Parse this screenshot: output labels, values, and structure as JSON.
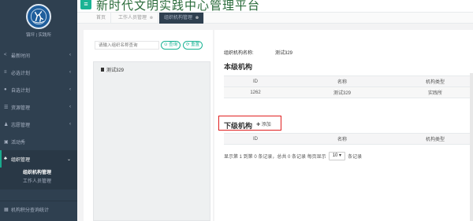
{
  "app": {
    "title": "新时代文明实践中心管理平台",
    "menu_icon": "hamburger-icon"
  },
  "profile": {
    "name": "镇坪 | 实践所",
    "logo_icon": "deer-emblem-icon"
  },
  "sidebar": {
    "items": [
      {
        "label": "最新时间",
        "icon": "share-icon"
      },
      {
        "label": "必选计划",
        "icon": "bars-icon"
      },
      {
        "label": "自选计划",
        "icon": "globe-icon"
      },
      {
        "label": "资源管理",
        "icon": "list-icon"
      },
      {
        "label": "志愿管理",
        "icon": "user-icon"
      },
      {
        "label": "活动秀",
        "icon": "image-icon"
      },
      {
        "label": "组织管理",
        "icon": "users-icon"
      }
    ],
    "sub_items": [
      {
        "label": "组织机构管理"
      },
      {
        "label": "工作人员管理"
      }
    ],
    "bottom_item": {
      "label": "机构积分查询统计",
      "icon": "table-icon"
    }
  },
  "tabs": [
    {
      "label": "首页"
    },
    {
      "label": "工作人员管理",
      "close": "⊗"
    },
    {
      "label": "组织机构管理",
      "close": "⊗"
    }
  ],
  "search": {
    "placeholder": "请输入组织名称查询",
    "query_label": "查询",
    "reset_label": "重置"
  },
  "tree": {
    "nodes": [
      {
        "label": "测试329"
      }
    ]
  },
  "detail": {
    "field_label": "组织机构名称:",
    "field_value": "测试329"
  },
  "current_org": {
    "title": "本级机构",
    "columns": [
      "ID",
      "名称",
      "机构类型"
    ],
    "rows": [
      {
        "id": "1262",
        "name": "测试329",
        "type": "实践所"
      }
    ]
  },
  "sub_orgs": {
    "title": "下级机构",
    "add_label": "添加",
    "columns": [
      "ID",
      "名称",
      "机构类型"
    ],
    "pager_prefix": "显示第 1 到第 0 条记录，总共 0 条记录 每页显示",
    "page_size": "10",
    "pager_suffix": "条记录"
  },
  "colors": {
    "sidebar": "#2f4050",
    "accent": "#1ab394",
    "highlight": "#e02020"
  }
}
